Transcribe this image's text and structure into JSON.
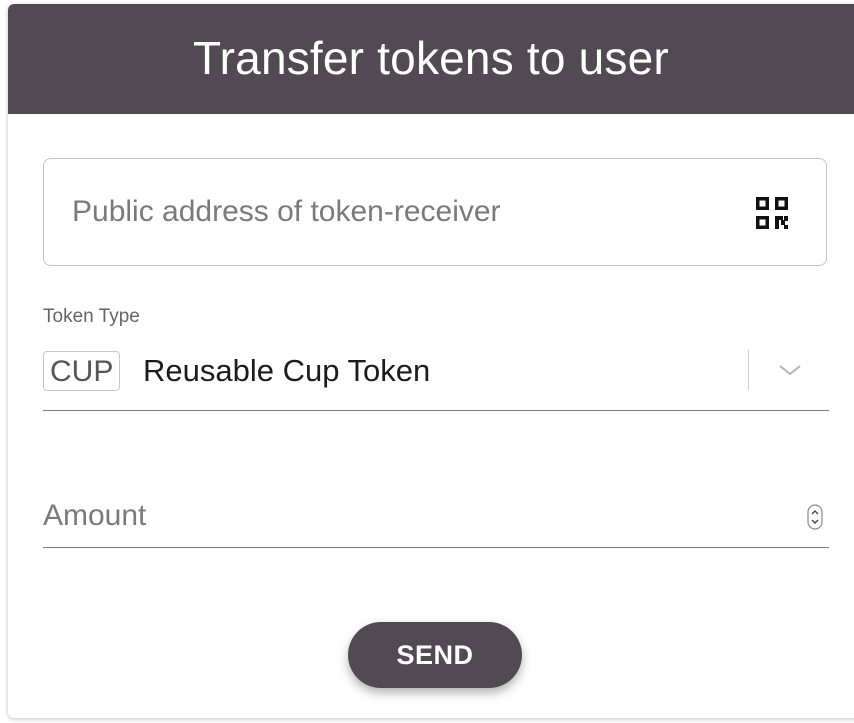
{
  "colors": {
    "header_bg": "#514a52",
    "button_bg": "#514a52",
    "underline": "#7c7c7c"
  },
  "header": {
    "title": "Transfer tokens to user"
  },
  "address_field": {
    "placeholder": "Public address of token-receiver",
    "value": "",
    "icon": "qr-code-icon"
  },
  "token_type": {
    "label": "Token Type",
    "selected_code": "CUP",
    "selected_name": "Reusable Cup Token",
    "icon": "chevron-down-icon"
  },
  "amount_field": {
    "placeholder": "Amount",
    "value": "",
    "icon": "number-stepper-icon"
  },
  "send_button": {
    "label": "SEND"
  }
}
